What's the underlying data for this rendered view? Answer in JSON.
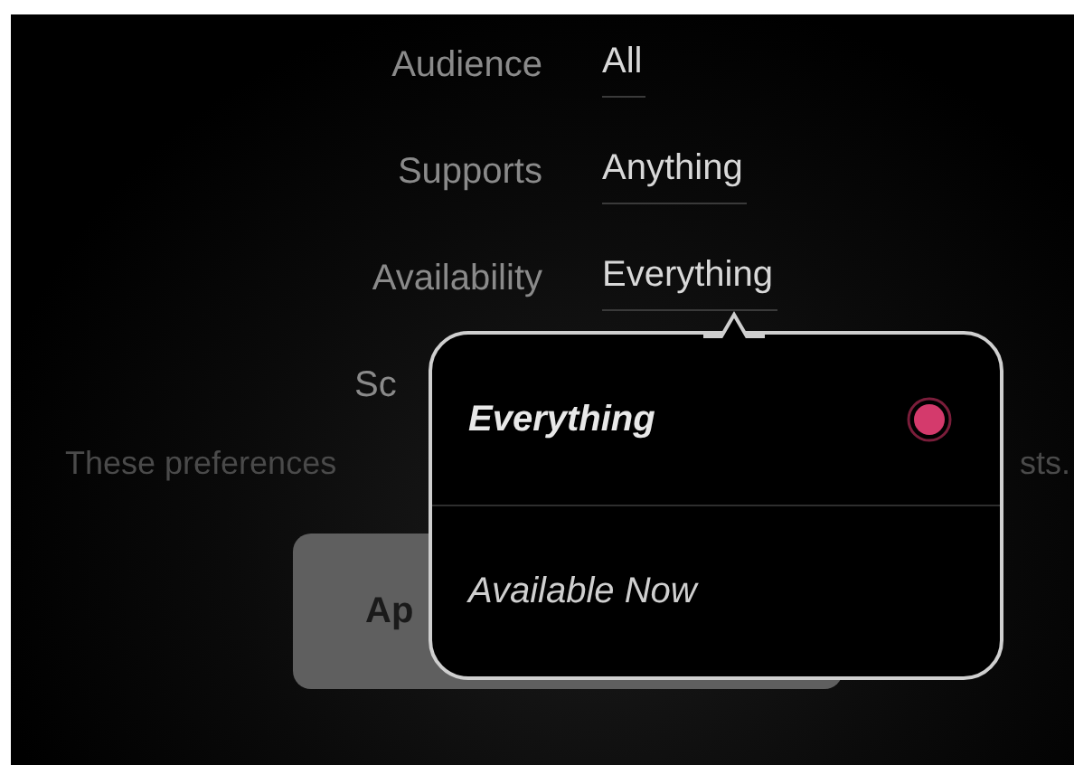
{
  "settings": [
    {
      "kind": "full",
      "label": "Audience",
      "value": "All"
    },
    {
      "kind": "full",
      "label": "Supports",
      "value": "Anything"
    },
    {
      "kind": "full",
      "label": "Availability",
      "value": "Everything"
    },
    {
      "kind": "partial",
      "label": "Sc"
    }
  ],
  "description": {
    "start": "These preferences",
    "end": "sts."
  },
  "button": {
    "label": "Ap"
  },
  "popover": {
    "options": [
      {
        "label": "Everything",
        "selected": true
      },
      {
        "label": "Available Now",
        "selected": false
      }
    ]
  }
}
